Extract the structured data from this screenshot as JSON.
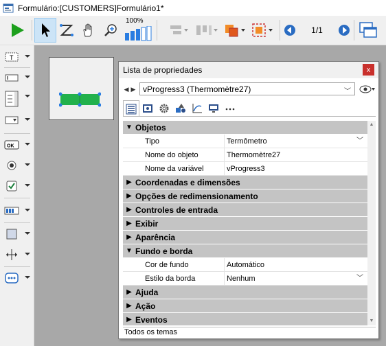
{
  "window": {
    "title": "Formulário:[CUSTOMERS]Formulário1*"
  },
  "toolbar": {
    "zoom_label": "100%",
    "page": "1/1"
  },
  "panel": {
    "title": "Lista de propriedades",
    "close": "x",
    "object_select": "vProgress3 (Thermomètre27)",
    "footer": "Todos os temas"
  },
  "property_grid": {
    "rows": [
      {
        "type": "category",
        "label": "Objetos",
        "expanded": true
      },
      {
        "type": "property",
        "name": "Tipo",
        "value": "Termômetro",
        "dropdown": true
      },
      {
        "type": "property",
        "name": "Nome do objeto",
        "value": "Thermomètre27"
      },
      {
        "type": "property",
        "name": "Nome da variável",
        "value": "vProgress3"
      },
      {
        "type": "category",
        "label": "Coordenadas e dimensões"
      },
      {
        "type": "category",
        "label": "Opções de redimensionamento"
      },
      {
        "type": "category",
        "label": "Controles de entrada"
      },
      {
        "type": "category",
        "label": "Exibir"
      },
      {
        "type": "category",
        "label": "Aparência"
      },
      {
        "type": "category",
        "label": "Fundo e borda",
        "expanded": true
      },
      {
        "type": "property",
        "name": "Cor de fundo",
        "value": "Automático"
      },
      {
        "type": "property",
        "name": "Estilo da borda",
        "value": "Nenhum",
        "dropdown": true
      },
      {
        "type": "category",
        "label": "Ajuda"
      },
      {
        "type": "category",
        "label": "Ação"
      },
      {
        "type": "category",
        "label": "Eventos"
      }
    ]
  },
  "colors": {
    "category_bg": "#c4c4c4",
    "canvas_bg": "#a8a8a8",
    "thermometer_fill": "#22b14c",
    "handle": "#2a7de1",
    "run_green": "#1da01d",
    "close_red": "#c9302c"
  },
  "icons": {
    "run": "play-icon",
    "select": "arrow-pointer-icon",
    "entry_order": "entry-order-icon",
    "hand": "hand-icon",
    "zoom": "magnifier-icon",
    "prev_page": "prev-page-icon",
    "next_page": "next-page-icon"
  }
}
